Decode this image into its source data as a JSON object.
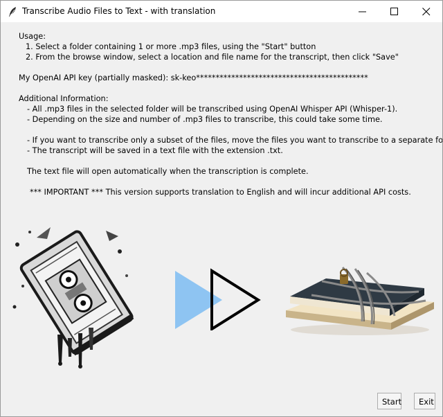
{
  "window": {
    "title": "Transcribe Audio Files to Text - with translation"
  },
  "text": {
    "usage_heading": "Usage:",
    "usage_1": "1. Select a folder containing 1 or more .mp3 files, using the \"Start\" button",
    "usage_2": "2. From the browse window, select a location and file name for the transcript, then click \"Save\"",
    "api_key_line": "My OpenAI API key (partially masked): sk-keo********************************************",
    "additional_heading": "Additional Information:",
    "info_1": "- All .mp3 files in the selected folder will be transcribed using OpenAI Whisper API (Whisper-1).",
    "info_2": "- Depending on the size and number of .mp3 files to transcribe, this could take some time.",
    "info_3": "- If you want to transcribe only a subset of the files, move the files you want to transcribe to a separate folder.",
    "info_4": "- The transcript will be saved in a text file with the extension .txt.",
    "info_5": "The text file will open automatically when the transcription is complete.",
    "important": "*** IMPORTANT *** This version supports translation to English and will incur additional API costs."
  },
  "buttons": {
    "start": "Start",
    "exit": "Exit"
  },
  "icons": {
    "app": "feather-icon",
    "minimize": "minimize-icon",
    "maximize": "maximize-icon",
    "close": "close-icon",
    "left_image": "cassette-tape-image",
    "middle_image": "fast-forward-arrows-image",
    "right_image": "chained-books-image"
  },
  "colors": {
    "window_bg": "#f0f0f0",
    "arrow_fill": "#8ec4f2",
    "arrow_outline": "#000000"
  }
}
